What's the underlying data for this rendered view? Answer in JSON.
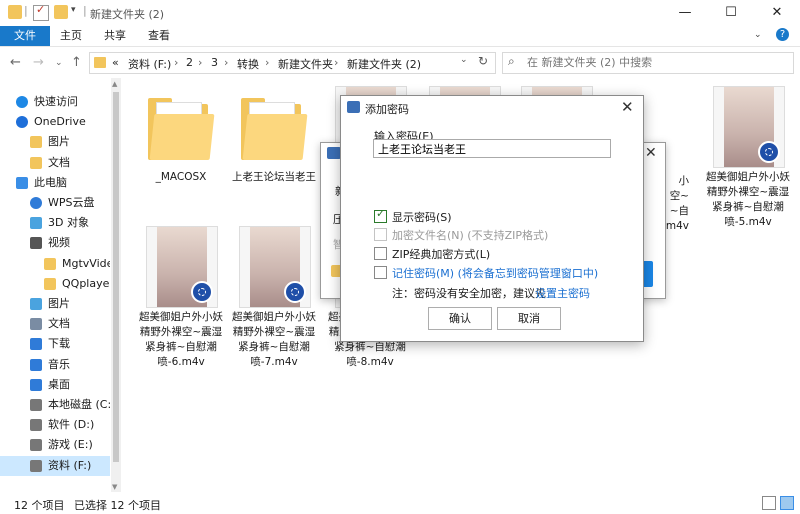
{
  "window": {
    "title": "新建文件夹 (2)",
    "controls": {
      "minimize": "—",
      "maximize": "☐",
      "close": "✕"
    }
  },
  "ribbon": {
    "tabs": [
      "文件",
      "主页",
      "共享",
      "查看"
    ],
    "help": "?"
  },
  "address": {
    "prefix": "«",
    "crumbs": [
      "资料 (F:)",
      "2",
      "3",
      "转换",
      "新建文件夹",
      "新建文件夹 (2)"
    ],
    "separator": "›"
  },
  "search": {
    "placeholder": "在 新建文件夹 (2) 中搜索"
  },
  "sidebar": {
    "items": [
      {
        "label": "快速访问",
        "icon": "star-icon",
        "color": "#1e88e5"
      },
      {
        "label": "OneDrive",
        "icon": "cloud-icon",
        "color": "#1e6fd9"
      },
      {
        "label": "图片",
        "icon": "folder-icon",
        "color": "#f2c55c"
      },
      {
        "label": "文档",
        "icon": "folder-icon",
        "color": "#f2c55c"
      },
      {
        "label": "此电脑",
        "icon": "computer-icon",
        "color": "#3a8ee6"
      },
      {
        "label": "WPS云盘",
        "icon": "cloud-icon",
        "color": "#2f7bd8"
      },
      {
        "label": "3D 对象",
        "icon": "cube-icon",
        "color": "#4aa3df"
      },
      {
        "label": "视频",
        "icon": "film-icon",
        "color": "#555555"
      },
      {
        "label": "MgtvVideos",
        "icon": "folder-icon",
        "color": "#f2c55c"
      },
      {
        "label": "QQplayerCl",
        "icon": "folder-icon",
        "color": "#f2c55c"
      },
      {
        "label": "图片",
        "icon": "picture-icon",
        "color": "#4aa3df"
      },
      {
        "label": "文档",
        "icon": "document-icon",
        "color": "#7a8ca3"
      },
      {
        "label": "下载",
        "icon": "download-icon",
        "color": "#2f7bd8"
      },
      {
        "label": "音乐",
        "icon": "music-icon",
        "color": "#2f7bd8"
      },
      {
        "label": "桌面",
        "icon": "desktop-icon",
        "color": "#2f7bd8"
      },
      {
        "label": "本地磁盘 (C:)",
        "icon": "drive-icon",
        "color": "#777777"
      },
      {
        "label": "软件 (D:)",
        "icon": "drive-icon",
        "color": "#777777"
      },
      {
        "label": "游戏 (E:)",
        "icon": "drive-icon",
        "color": "#777777"
      },
      {
        "label": "资料 (F:)",
        "icon": "drive-icon",
        "color": "#777777",
        "selected": true
      }
    ]
  },
  "files": [
    {
      "name": "_MACOSX",
      "kind": "folder"
    },
    {
      "name": "上老王论坛当老王",
      "kind": "folder"
    },
    {
      "name": "",
      "kind": "video"
    },
    {
      "name": "",
      "kind": "video"
    },
    {
      "name": "",
      "kind": "video"
    },
    {
      "name": "超美御姐户外小妖精野外裸空~震湿紧身裤~自慰潮喷-5.m4v",
      "kind": "video"
    },
    {
      "name": "超美御姐户外小妖精野外裸空~震湿紧身裤~自慰潮喷-6.m4v",
      "kind": "video"
    },
    {
      "name": "超美御姐户外小妖精野外裸空~震湿紧身裤~自慰潮喷-7.m4v",
      "kind": "video"
    },
    {
      "name": "超美御姐户外小妖精野外裸空~震湿紧身裤~自慰潮喷-8.m4v",
      "kind": "video"
    }
  ],
  "partial_labels": {
    "tile4_lines": [
      "超美御姐户外小",
      "妖精野外裸空~",
      "震湿紧身裤~自",
      "慰潮喷-4.m4v"
    ],
    "tile9_visible": [
      "小",
      "空~",
      "~自",
      "m4v"
    ]
  },
  "status": {
    "count": "12 个项目",
    "selected": "已选择 12 个项目"
  },
  "dialog": {
    "title": "添加密码",
    "close": "✕",
    "password_label": "输入密码(E)",
    "password_value": "上老王论坛当老王",
    "options": [
      {
        "label": "显示密码(S)",
        "checked": true,
        "enabled": true
      },
      {
        "label": "加密文件名(N)  (不支持ZIP格式)",
        "checked": false,
        "enabled": false
      },
      {
        "label": "ZIP经典加密方式(L)",
        "checked": false,
        "enabled": true
      },
      {
        "label": "记住密码(M)  (将会备忘到密码管理窗口中)",
        "checked": false,
        "enabled": true,
        "color": "#1a6fd1"
      }
    ],
    "note_prefix": "注：密码没有安全加密，建议先",
    "note_link": "设置主密码",
    "ok": "确认",
    "cancel": "取消"
  },
  "background_dialog": {
    "fragments": [
      "新",
      "压",
      "智"
    ]
  },
  "colors": {
    "accent": "#1979ca",
    "link": "#1a6fd1",
    "selection": "#cce8ff"
  }
}
